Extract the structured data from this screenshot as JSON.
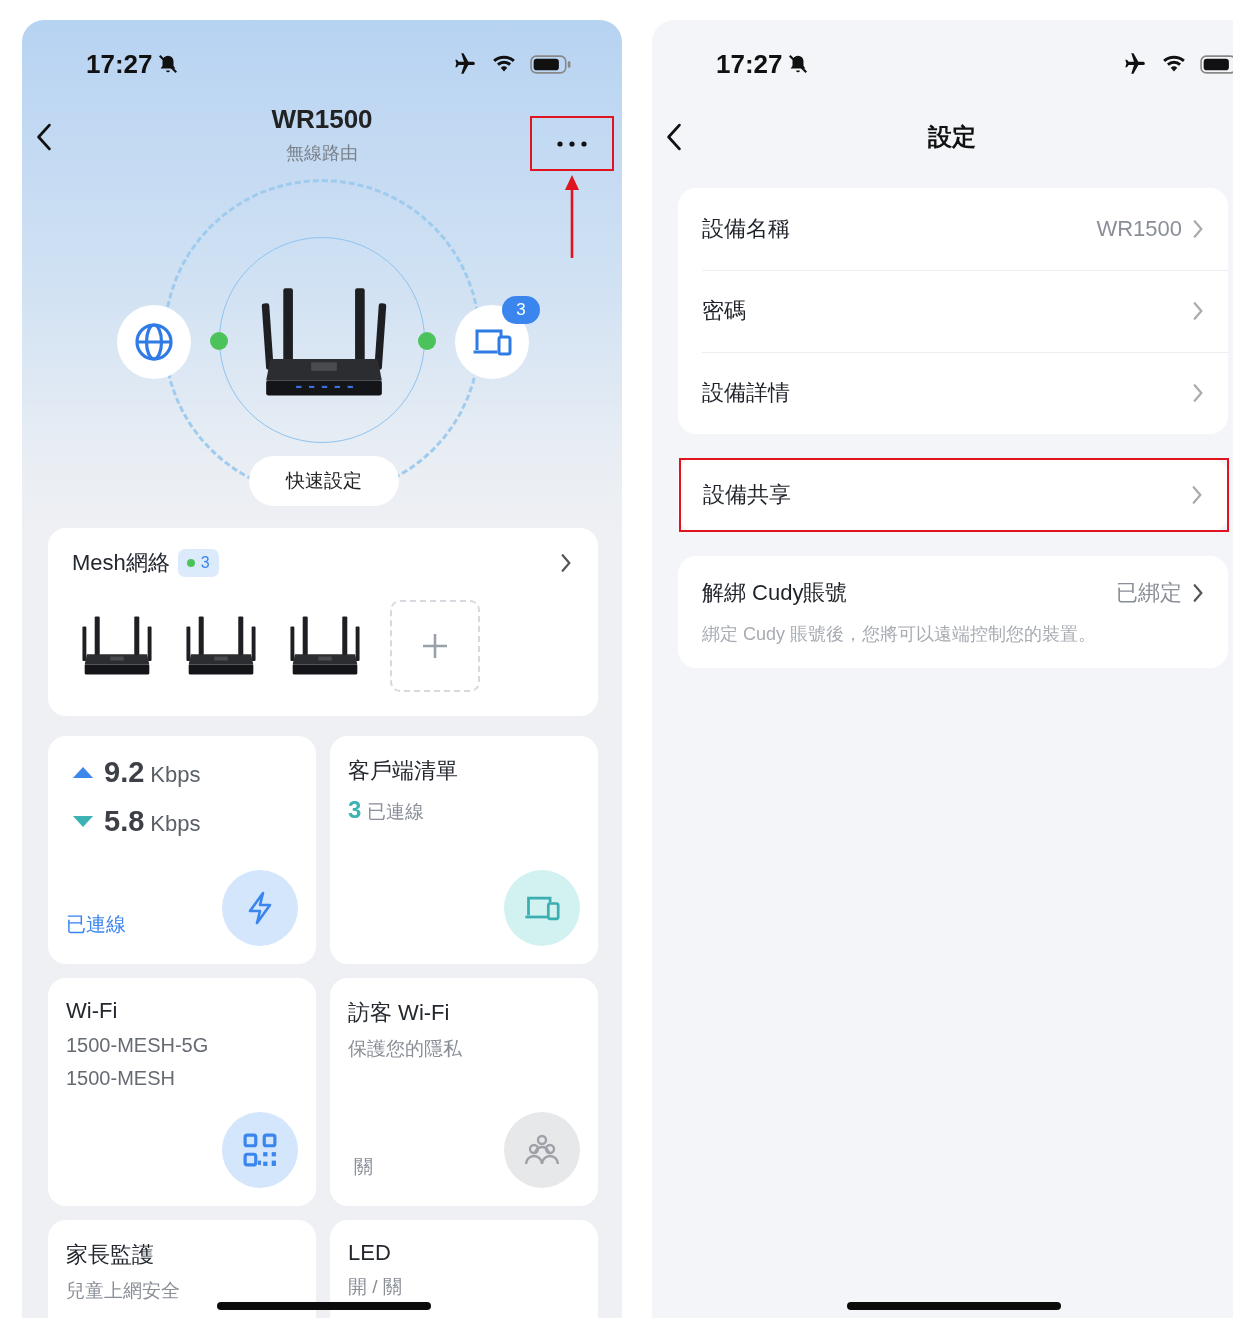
{
  "device_screen": {
    "status_bar": {
      "time": "17:27"
    },
    "title": "WR1500",
    "subtitle": "無線路由",
    "more_button": {
      "highlighted": true
    },
    "topology": {
      "internet_connected": true,
      "clients_connected": true,
      "clients_badge": "3",
      "button": "快速設定"
    },
    "mesh": {
      "title": "Mesh網絡",
      "count": "3",
      "nodes": [
        {
          "kind": "router"
        },
        {
          "kind": "router"
        },
        {
          "kind": "router"
        },
        {
          "kind": "add"
        }
      ]
    },
    "cards": [
      {
        "kind": "speed",
        "upload": "9.2",
        "upload_unit": "Kbps",
        "download": "5.8",
        "download_unit": "Kbps",
        "status": "已連線"
      },
      {
        "kind": "clients",
        "title": "客戶端清單",
        "count": "3",
        "status": "已連線"
      },
      {
        "kind": "wifi",
        "title": "Wi-Fi",
        "lines": [
          "1500-MESH-5G",
          "1500-MESH"
        ]
      },
      {
        "kind": "guest",
        "title": "訪客 Wi-Fi",
        "subtitle": "保護您的隱私",
        "status": "關",
        "on": false
      },
      {
        "kind": "parental",
        "title": "家長監護",
        "subtitle": "兒童上網安全"
      },
      {
        "kind": "led",
        "title": "LED",
        "subtitle": "開 / 關"
      }
    ]
  },
  "settings_screen": {
    "status_bar": {
      "time": "17:27"
    },
    "title": "設定",
    "groups": [
      {
        "rows": [
          {
            "label": "設備名稱",
            "value": "WR1500",
            "highlighted": false
          },
          {
            "label": "密碼",
            "highlighted": false
          },
          {
            "label": "設備詳情",
            "highlighted": false
          }
        ]
      },
      {
        "rows": [
          {
            "label": "設備共享",
            "highlighted": true
          }
        ]
      },
      {
        "rows": [
          {
            "label": "解綁 Cudy賬號",
            "value": "已綁定",
            "note": "綁定 Cudy 賬號後，您將可以遠端控制您的裝置。",
            "highlighted": false
          }
        ]
      }
    ]
  }
}
